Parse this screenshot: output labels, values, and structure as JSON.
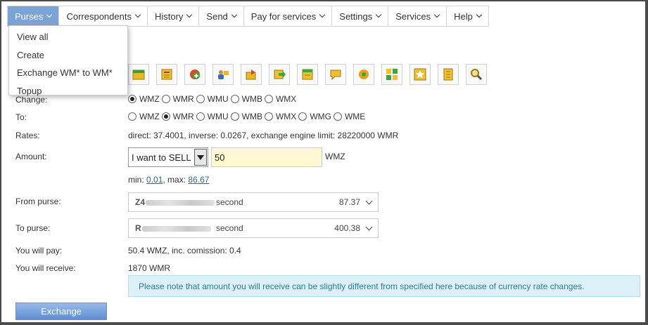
{
  "menu": {
    "items": [
      {
        "label": "Purses",
        "active": true
      },
      {
        "label": "Correspondents"
      },
      {
        "label": "History"
      },
      {
        "label": "Send"
      },
      {
        "label": "Pay for services"
      },
      {
        "label": "Settings"
      },
      {
        "label": "Services"
      },
      {
        "label": "Help"
      }
    ],
    "dropdown": [
      "View all",
      "Create",
      "Exchange WM* to WM*",
      "Topup"
    ]
  },
  "toolbar": {
    "icons": [
      "purse-icon",
      "invoice-icon",
      "add-purse-icon",
      "contacts-icon",
      "transfer-icon",
      "send-icon",
      "receipt-icon",
      "message-icon",
      "settings-icon",
      "grid-icon",
      "favorite-icon",
      "notes-icon",
      "search-icon"
    ]
  },
  "form": {
    "change_label": "Change:",
    "change_options": [
      "WMZ",
      "WMR",
      "WMU",
      "WMB",
      "WMX"
    ],
    "change_selected": "WMZ",
    "to_label": "To:",
    "to_options": [
      "WMZ",
      "WMR",
      "WMU",
      "WMB",
      "WMX",
      "WMG",
      "WME"
    ],
    "to_selected": "WMR",
    "rates_label": "Rates:",
    "rates_value": "direct: 37.4001, inverse: 0.0267, exchange engine limit: 28220000 WMR",
    "amount_label": "Amount:",
    "mode_value": "I want to SELL",
    "amount_value": "50",
    "amount_currency": "WMZ",
    "min_label": "min:",
    "min_value": "0.01",
    "max_label": ", max:",
    "max_value": "86.67",
    "from_label": "From purse:",
    "from_prefix": "Z4",
    "from_name": "second",
    "from_balance": "87.37",
    "to_purse_label": "To purse:",
    "to_prefix": "R",
    "to_name": "second",
    "to_balance": "400.38",
    "pay_label": "You will pay:",
    "pay_value": "50.4 WMZ, inc. comission: 0.4",
    "receive_label": "You will receive:",
    "receive_value": "1870 WMR",
    "note": "Please note that amount you will receive can be slightly different from specified here because of currency rate changes.",
    "exchange_button": "Exchange"
  },
  "colors": {
    "accent": "#7aa3d6",
    "note_bg": "#dcf0f7",
    "amount_bg": "#fff8d2"
  }
}
